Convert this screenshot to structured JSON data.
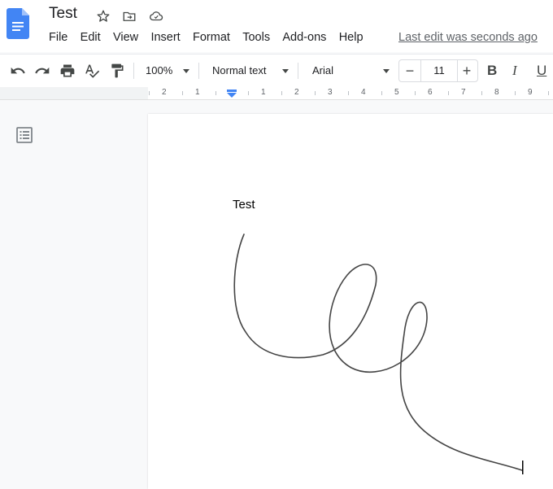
{
  "app": {
    "doc_title": "Test",
    "logo_icon": "google-docs-icon",
    "title_icons": [
      "star-icon",
      "move-to-folder-icon",
      "cloud-saved-icon"
    ],
    "brand_color": "#4285f4"
  },
  "menu": {
    "items": [
      "File",
      "Edit",
      "View",
      "Insert",
      "Format",
      "Tools",
      "Add-ons",
      "Help"
    ],
    "last_edit": "Last edit was seconds ago"
  },
  "toolbar": {
    "undo_icon": "undo-icon",
    "redo_icon": "redo-icon",
    "print_icon": "print-icon",
    "spellcheck_icon": "spellcheck-icon",
    "paint_format_icon": "paint-format-icon",
    "zoom": "100%",
    "style": "Normal text",
    "font": "Arial",
    "font_size": "11",
    "minus": "−",
    "plus": "+",
    "bold": "B",
    "italic": "I",
    "underline": "U"
  },
  "ruler": {
    "labels": [
      "2",
      "1",
      "1",
      "2",
      "3",
      "4",
      "5",
      "6",
      "7",
      "8",
      "9"
    ]
  },
  "sidebar": {
    "outline_icon": "document-outline-icon"
  },
  "document": {
    "text": "Test",
    "drawing": "freehand-scribble"
  }
}
